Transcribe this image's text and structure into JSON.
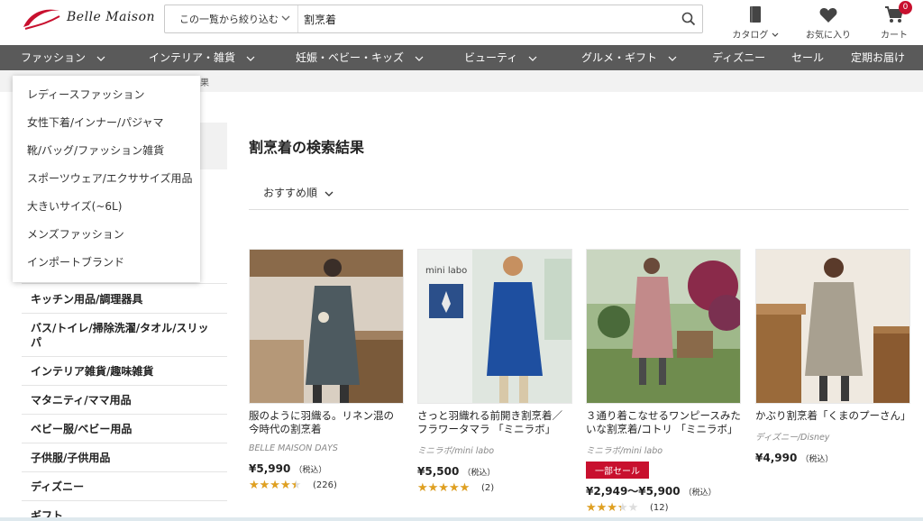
{
  "header": {
    "logo_text": "Belle Maison",
    "filter_label": "この一覧から絞り込む",
    "search_value": "割烹着",
    "catalog_label": "カタログ",
    "favorites_label": "お気に入り",
    "cart_label": "カート",
    "cart_count": "0"
  },
  "nav": {
    "items": [
      {
        "label": "ファッション"
      },
      {
        "label": "インテリア・雑貨"
      },
      {
        "label": "妊娠・ベビー・キッズ"
      },
      {
        "label": "ビューティ"
      },
      {
        "label": "グルメ・ギフト"
      },
      {
        "label": "ディズニー"
      },
      {
        "label": "セール"
      },
      {
        "label": "定期お届け"
      }
    ]
  },
  "breadcrumb_fragment": "果",
  "dropdown": {
    "items": [
      "レディースファッション",
      "女性下着/インナー/パジャマ",
      "靴/バッグ/ファッション雑貨",
      "スポーツウェア/エクササイズ用品",
      "大きいサイズ(~6L)",
      "メンズファッション",
      "インポートブランド"
    ]
  },
  "sidebar": {
    "items": [
      "キッチン用品/調理器具",
      "バス/トイレ/掃除洗濯/タオル/スリッパ",
      "インテリア雑貨/趣味雑貨",
      "マタニティ/ママ用品",
      "ベビー服/ベビー用品",
      "子供服/子供用品",
      "ディズニー",
      "ギフト"
    ]
  },
  "results": {
    "title": "割烹着の検索結果",
    "sort_label": "おすすめ順"
  },
  "products": [
    {
      "name": "服のように羽織る。リネン混の今時代の割烹着",
      "brand": "BELLE MAISON DAYS",
      "price": "¥5,990",
      "tax": "（税込）",
      "rating": 4.0,
      "reviews": "(226)",
      "sale": ""
    },
    {
      "name": "さっと羽織れる前開き割烹着／フラワータマラ 「ミニラボ」",
      "brand": "ミニラボ/mini labo",
      "price": "¥5,500",
      "tax": "（税込）",
      "rating": 4.5,
      "reviews": "(2)",
      "sale": "",
      "image_text": "mini labo"
    },
    {
      "name": "３通り着こなせるワンピースみたいな割烹着/コトリ 「ミニラボ」",
      "brand": "ミニラボ/mini labo",
      "price": "¥2,949〜¥5,900",
      "tax": "（税込）",
      "rating": 3.0,
      "reviews": "(12)",
      "sale": "一部セール"
    },
    {
      "name": "かぶり割烹着「くまのプーさん」",
      "brand": "ディズニー/Disney",
      "price": "¥4,990",
      "tax": "（税込）",
      "rating": null,
      "reviews": "",
      "sale": ""
    }
  ],
  "colors": {
    "nav_bg": "#5a5a5a",
    "accent_red": "#c8102e",
    "star": "#e0a020"
  }
}
